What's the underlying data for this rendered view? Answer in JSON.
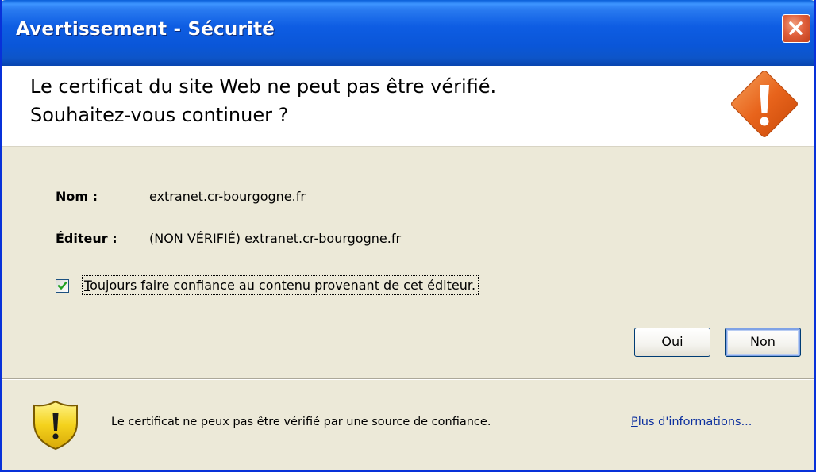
{
  "window": {
    "title": "Avertissement - Sécurité",
    "close_icon": "close-icon"
  },
  "header": {
    "line1": "Le certificat du site Web ne peut pas être vérifié.",
    "line2": "Souhaitez-vous continuer ?",
    "icon": "warning-diamond-icon",
    "icon_color": "#e8641c"
  },
  "details": {
    "name_label": "Nom :",
    "name_value": "extranet.cr-bourgogne.fr",
    "publisher_label": "Éditeur :",
    "publisher_value": "(NON VÉRIFIÉ) extranet.cr-bourgogne.fr"
  },
  "trust_checkbox": {
    "checked": true,
    "label_access_key": "T",
    "label_rest": "oujours faire confiance au contenu provenant de cet éditeur."
  },
  "buttons": {
    "yes": "Oui",
    "no": "Non"
  },
  "footer": {
    "icon": "warning-shield-icon",
    "message": "Le certificat ne peux pas être vérifié par une source de confiance.",
    "link_access_key": "P",
    "link_rest": "lus d'informations..."
  },
  "colors": {
    "titlebar": "#0a56d8",
    "dialog_bg": "#ece9d8",
    "link": "#0b2f9e",
    "close_button": "#e0603c"
  }
}
